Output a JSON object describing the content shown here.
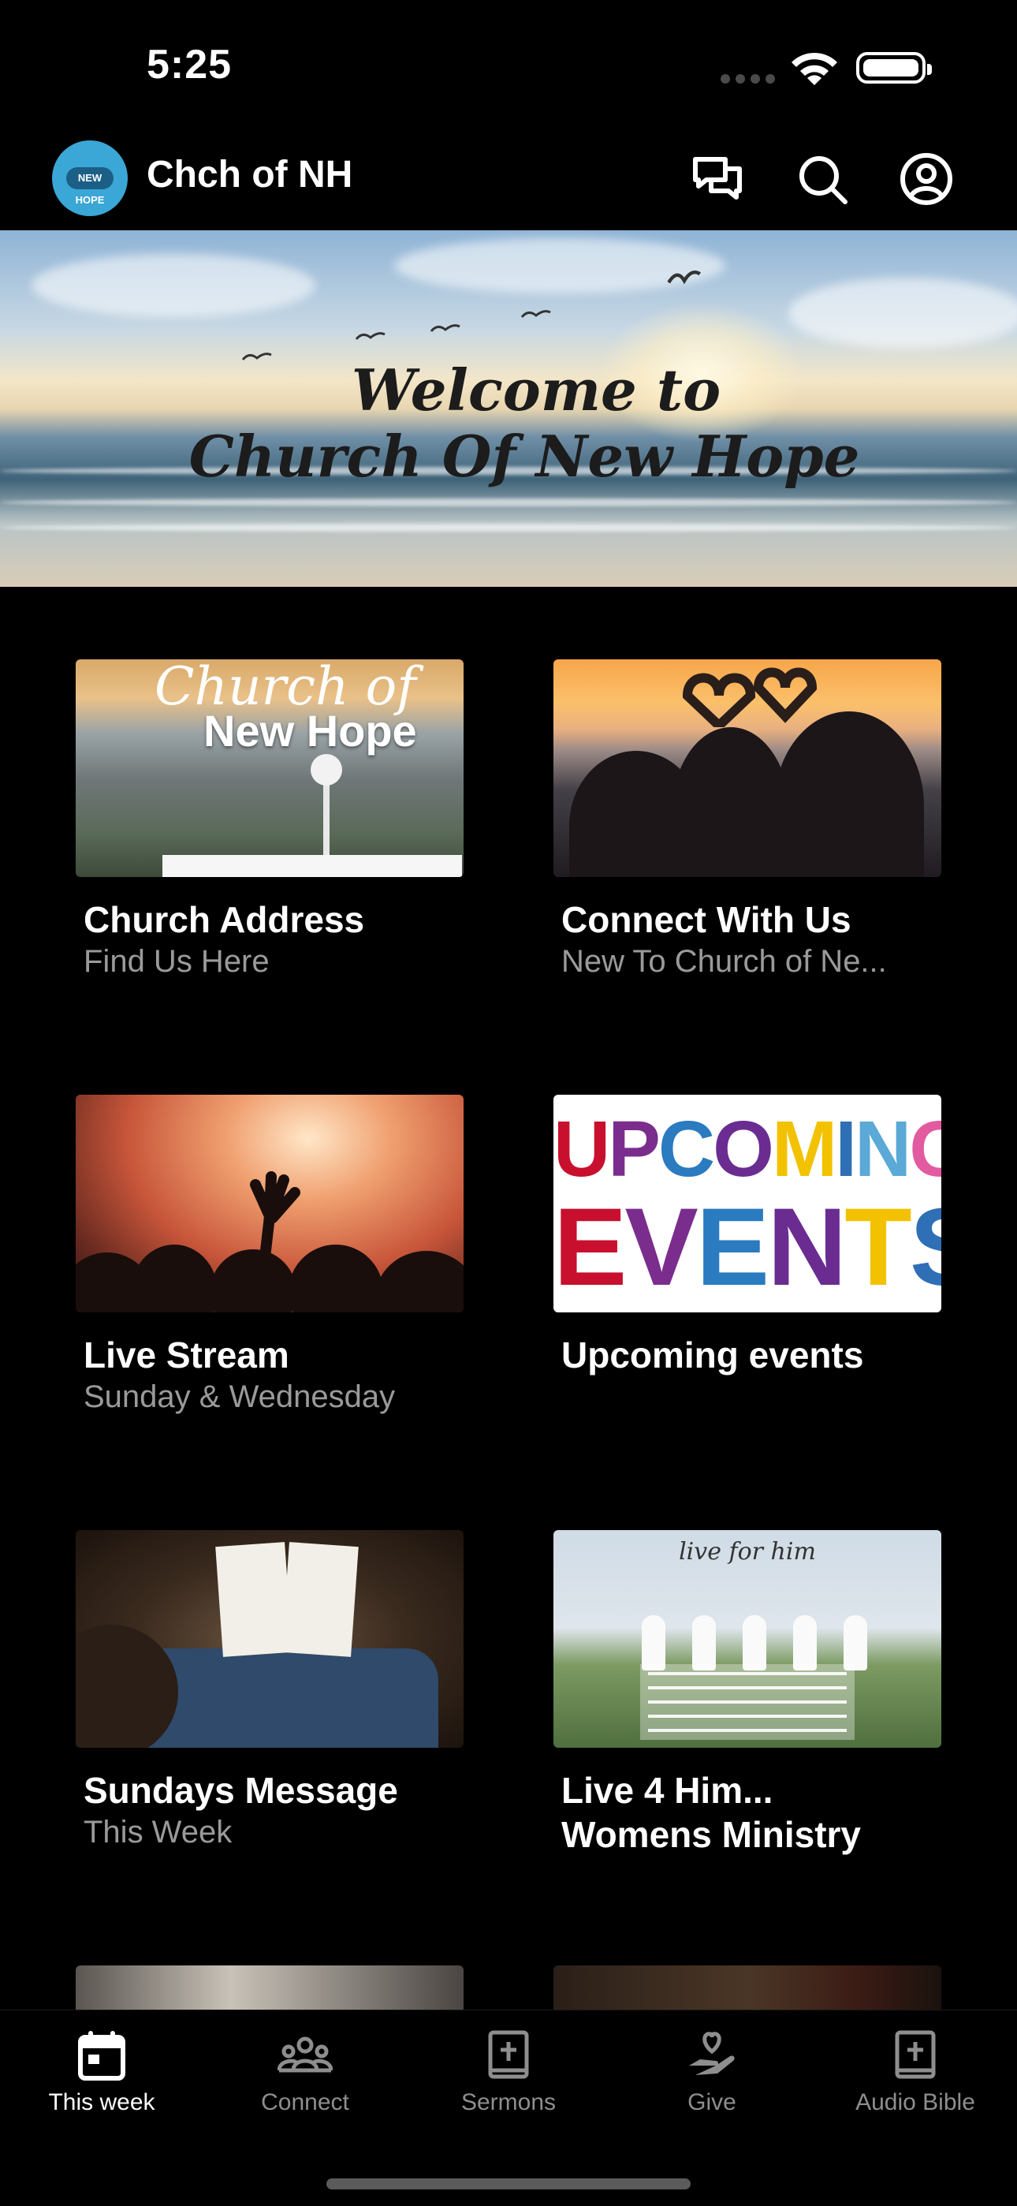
{
  "status_bar": {
    "time": "5:25"
  },
  "header": {
    "logo_text": "NEW HOPE",
    "title": "Chch of NH",
    "icons": [
      "chat-icon",
      "search-icon",
      "profile-icon"
    ]
  },
  "banner": {
    "line1": "Welcome to",
    "line2": "Church Of New Hope"
  },
  "cards": [
    {
      "title": "Church Address",
      "subtitle": "Find Us Here",
      "thumb_script": "Church of",
      "thumb_bold": "New Hope"
    },
    {
      "title": "Connect With Us",
      "subtitle": "New To Church of Ne..."
    },
    {
      "title": "Live Stream",
      "subtitle": "Sunday & Wednesday"
    },
    {
      "title": "Upcoming events",
      "subtitle": "",
      "thumb_word1": "UPCOMING",
      "thumb_word2": "EVENTS"
    },
    {
      "title": "Sundays Message",
      "subtitle": "This Week"
    },
    {
      "title": "Live 4 Him...",
      "title_line2": "Womens Ministry",
      "subtitle": "",
      "thumb_header": "live for him"
    }
  ],
  "tabs": [
    {
      "label": "This week",
      "icon": "calendar-icon",
      "active": true
    },
    {
      "label": "Connect",
      "icon": "people-icon",
      "active": false
    },
    {
      "label": "Sermons",
      "icon": "bible-icon",
      "active": false
    },
    {
      "label": "Give",
      "icon": "give-icon",
      "active": false
    },
    {
      "label": "Audio Bible",
      "icon": "audio-bible-icon",
      "active": false
    }
  ],
  "colors": {
    "background": "#000000",
    "text": "#ffffff",
    "subtitle": "#9a9a9a",
    "tab_inactive": "#8e8e8e",
    "logo": "#3aa7d6"
  }
}
